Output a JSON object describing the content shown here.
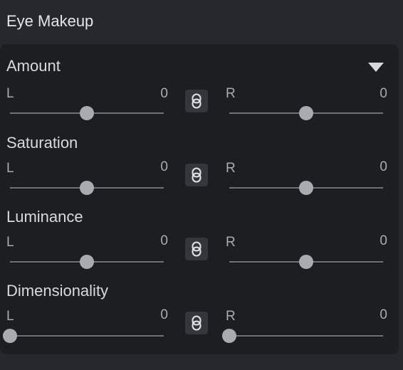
{
  "header": {
    "title": "Eye Makeup"
  },
  "icons": {
    "dropdown": "triangle-down-icon",
    "link": "link-chain-icon"
  },
  "sections": [
    {
      "title": "Amount",
      "left_label": "L",
      "left_value": "0",
      "right_label": "R",
      "right_value": "0",
      "left_level": 0.5,
      "right_level": 0.5
    },
    {
      "title": "Saturation",
      "left_label": "L",
      "left_value": "0",
      "right_label": "R",
      "right_value": "0",
      "left_level": 0.5,
      "right_level": 0.5
    },
    {
      "title": "Luminance",
      "left_label": "L",
      "left_value": "0",
      "right_label": "R",
      "right_value": "0",
      "left_level": 0.5,
      "right_level": 0.5
    },
    {
      "title": "Dimensionality",
      "left_label": "L",
      "left_value": "0",
      "right_label": "R",
      "right_value": "0",
      "left_level": 0.0,
      "right_level": 0.0
    }
  ],
  "colors": {
    "background": "#25282c",
    "panel": "#1c1e21",
    "track": "#6e7276",
    "thumb": "#a8abaf"
  }
}
